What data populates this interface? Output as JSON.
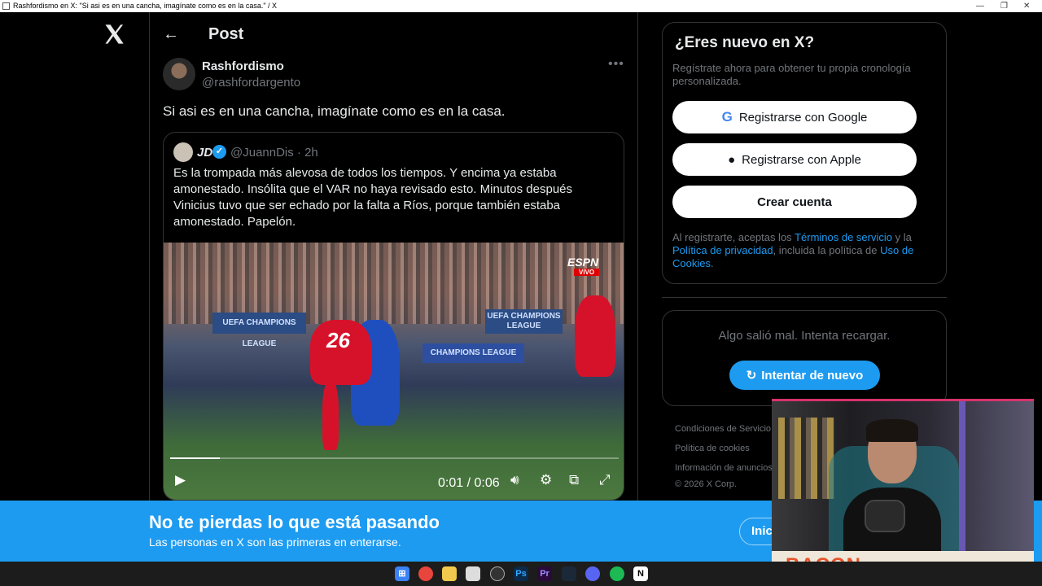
{
  "window": {
    "title": "Rashfordismo en X: \"Si asi es en una cancha, imagínate como es en la casa.\" / X"
  },
  "header": {
    "title": "Post"
  },
  "post": {
    "author_name": "Rashfordismo",
    "author_handle": "@rashfordargento",
    "text": "Si asi es en una cancha, imagínate como es en la casa."
  },
  "quote": {
    "author_name": "JD",
    "author_handle": "@JuannDis · 2h",
    "text": "Es la trompada más alevosa de todos los tiempos. Y encima ya estaba amonestado. Insólita que el VAR no haya revisado esto. Minutos después Vinicius tuvo que ser echado por la falta a Ríos, porque también estaba amonestado. Papelón.",
    "video": {
      "time": "0:01 / 0:06",
      "progress_fraction": 0.11,
      "overlay_brand": "ESPN",
      "overlay_live": "VIVO",
      "board_1": "UEFA CHAMPIONS LEAGUE",
      "board_2": "UEFA CHAMPIONS LEAGUE",
      "board_3": "CHAMPIONS LEAGUE",
      "jersey_number": "26"
    }
  },
  "sidebar": {
    "title": "¿Eres nuevo en X?",
    "description": "Regístrate ahora para obtener tu propia cronología personalizada.",
    "google_label": "Registrarse con Google",
    "apple_label": "Registrarse con Apple",
    "create_label": "Crear cuenta",
    "legal_1": "Al registrarte, aceptas los ",
    "legal_terms": "Términos de servicio",
    "legal_2": " y la ",
    "legal_privacy": "Política de privacidad",
    "legal_3": ", incluida la política de ",
    "legal_cookies": "Uso de Cookies",
    "legal_4": ".",
    "error_text": "Algo salió mal. Intenta recargar.",
    "retry_label": "Intentar de nuevo",
    "footer": {
      "terms": "Condiciones de Servicio",
      "cookies": "Política de cookies",
      "ads": "Información de anuncios",
      "copyright": "© 2026 X Corp."
    }
  },
  "banner": {
    "title": "No te pierdas lo que está pasando",
    "subtitle": "Las personas en X son las primeras en enterarse.",
    "login_label": "Inic"
  },
  "webcam": {
    "overlay_text": "BACON"
  },
  "colors": {
    "accent": "#1d9bf0",
    "background": "#000000",
    "muted": "#71767b"
  }
}
